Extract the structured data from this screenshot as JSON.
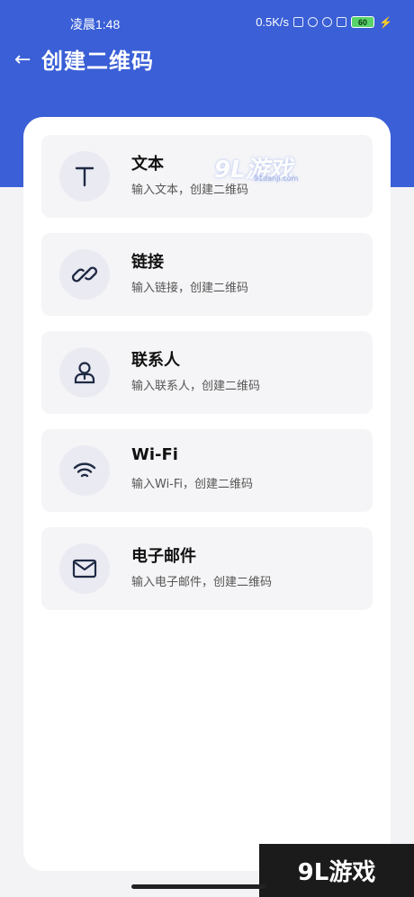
{
  "status_bar": {
    "time": "凌晨1:48",
    "network_speed": "0.5K/s",
    "battery_level": "60"
  },
  "header": {
    "back_icon": "←",
    "title": "创建二维码"
  },
  "options": [
    {
      "label": "文本",
      "subtitle": "输入文本，创建二维码",
      "icon": "text-icon"
    },
    {
      "label": "链接",
      "subtitle": "输入链接，创建二维码",
      "icon": "link-icon"
    },
    {
      "label": "联系人",
      "subtitle": "输入联系人，创建二维码",
      "icon": "contact-icon"
    },
    {
      "label": "Wi-Fi",
      "subtitle": "输入Wi-Fi，创建二维码",
      "icon": "wifi-icon"
    },
    {
      "label": "电子邮件",
      "subtitle": "输入电子邮件，创建二维码",
      "icon": "mail-icon"
    }
  ],
  "watermark": {
    "brand": "9L游戏",
    "url": "91danji.com"
  },
  "colors": {
    "header_bg": "#3a5fd6",
    "card_bg": "#f5f5f7",
    "icon_circle_bg": "#eaeaf2",
    "icon_stroke": "#1f2a44"
  }
}
